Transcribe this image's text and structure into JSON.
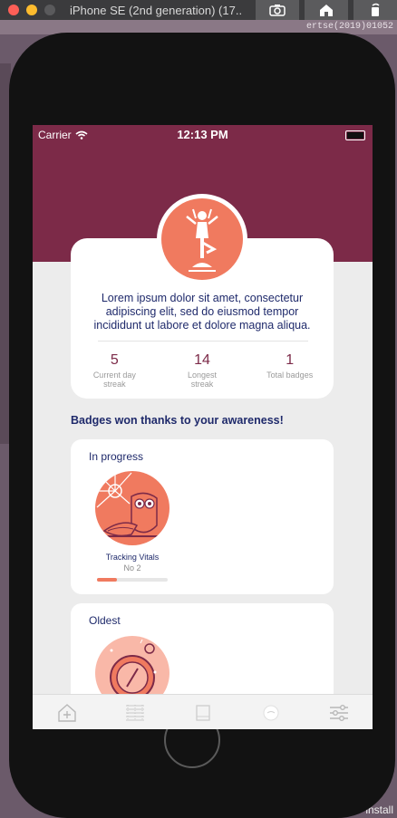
{
  "window": {
    "title": "iPhone SE (2nd generation) (17..."
  },
  "desktop": {
    "strip_text": "ertse(2019)01052",
    "install_text": "install"
  },
  "status_bar": {
    "carrier": "Carrier",
    "time": "12:13 PM"
  },
  "profile": {
    "intro": "Lorem ipsum dolor sit amet, consectetur adipiscing elit, sed do eiusmod tempor incididunt ut labore et dolore magna aliqua.",
    "stats": [
      {
        "value": "5",
        "label": "Current day streak"
      },
      {
        "value": "14",
        "label": "Longest streak"
      },
      {
        "value": "1",
        "label": "Total badges"
      }
    ]
  },
  "section_title": "Badges won thanks to your awareness!",
  "in_progress": {
    "title": "In progress",
    "badge_name": "Tracking Vitals",
    "badge_sub": "No 2",
    "progress": 0.28
  },
  "oldest": {
    "title": "Oldest"
  },
  "colors": {
    "header": "#7c2a48",
    "accent": "#f07a5f",
    "navy": "#1f2a6b"
  },
  "tabs": [
    "add-icon",
    "grid-icon",
    "book-icon",
    "chat-icon",
    "sliders-icon"
  ]
}
